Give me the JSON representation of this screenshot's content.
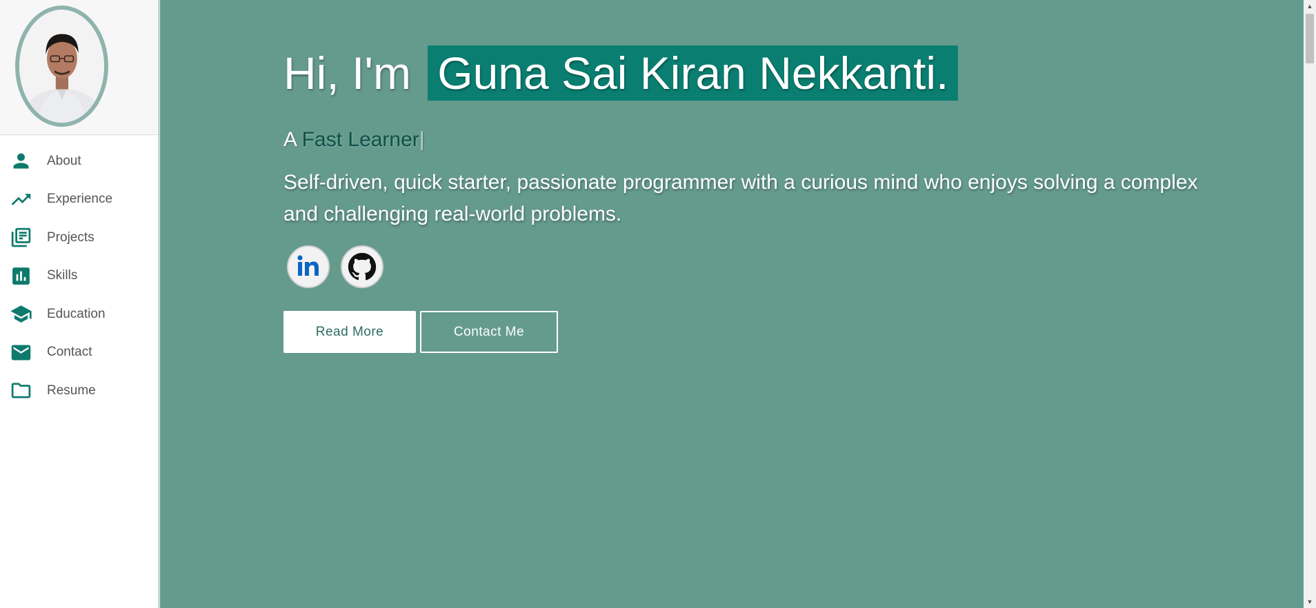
{
  "sidebar": {
    "items": [
      {
        "label": "About",
        "icon": "person-icon"
      },
      {
        "label": "Experience",
        "icon": "trending-up-icon"
      },
      {
        "label": "Projects",
        "icon": "library-books-icon"
      },
      {
        "label": "Skills",
        "icon": "bar-chart-icon"
      },
      {
        "label": "Education",
        "icon": "school-icon"
      },
      {
        "label": "Contact",
        "icon": "mail-icon"
      },
      {
        "label": "Resume",
        "icon": "folder-icon"
      }
    ]
  },
  "hero": {
    "greeting": "Hi, I'm",
    "name": "Guna Sai Kiran Nekkanti.",
    "tagline_prefix": "A",
    "tagline_typed": "Fast Learner",
    "tagline_cursor": "|",
    "bio": "Self-driven, quick starter, passionate programmer with a curious mind who enjoys solving a complex and challenging real-world problems.",
    "socials": [
      {
        "name": "linkedin-icon"
      },
      {
        "name": "github-icon"
      }
    ],
    "buttons": {
      "read_more": "Read More",
      "contact_me": "Contact Me"
    }
  },
  "colors": {
    "accent": "#0e7a6d",
    "hero_background": "#659b8d",
    "name_highlight": "#0a7f71",
    "typed_text": "#0f5148"
  }
}
